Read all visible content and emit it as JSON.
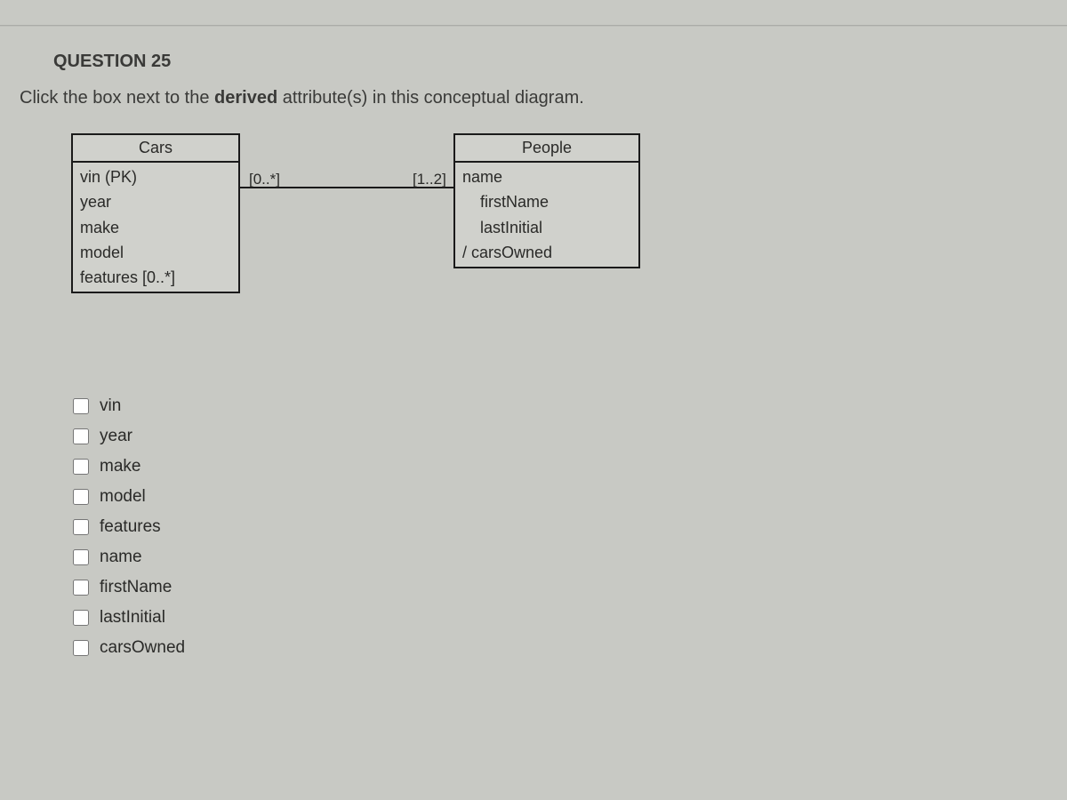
{
  "question": {
    "number_label": "QUESTION 25",
    "prompt_prefix": "Click the box next to the ",
    "prompt_bold": "derived",
    "prompt_suffix": " attribute(s) in this conceptual diagram."
  },
  "diagram": {
    "cars": {
      "title": "Cars",
      "attributes": [
        "vin (PK)",
        "year",
        "make",
        "model",
        "features [0..*]"
      ]
    },
    "people": {
      "title": "People",
      "name_label": "name",
      "name_sub": [
        "firstName",
        "lastInitial"
      ],
      "derived": "/ carsOwned"
    },
    "multiplicity_left": "[0..*]",
    "multiplicity_right": "[1..2]"
  },
  "options": [
    {
      "label": "vin",
      "checked": false
    },
    {
      "label": "year",
      "checked": false
    },
    {
      "label": "make",
      "checked": false
    },
    {
      "label": "model",
      "checked": false
    },
    {
      "label": "features",
      "checked": false
    },
    {
      "label": "name",
      "checked": false
    },
    {
      "label": "firstName",
      "checked": false
    },
    {
      "label": "lastInitial",
      "checked": false
    },
    {
      "label": "carsOwned",
      "checked": false
    }
  ]
}
